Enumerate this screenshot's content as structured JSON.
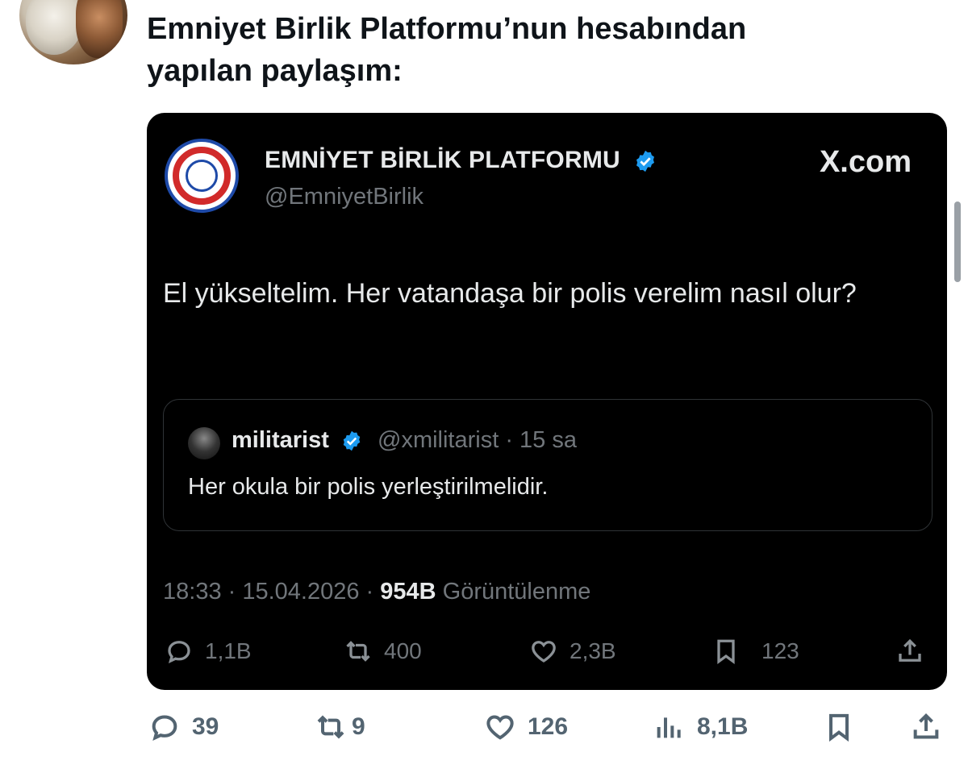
{
  "tweet": {
    "text": "Emniyet Birlik Platformu’nun hesabından\nyapılan paylaşım:"
  },
  "embedded_post": {
    "account_name": "EMNİYET BİRLİK PLATFORMU",
    "account_handle": "@EmniyetBirlik",
    "source": "X.com",
    "body": "El yükseltelim. Her vatandaşa bir polis verelim nasıl olur?",
    "quote": {
      "name": "militarist",
      "handle_time": "@xmilitarist · 15 sa",
      "body": "Her okula bir polis yerleştirilmelidir."
    },
    "timestamp": "18:33 · 15.04.2026 · ",
    "views_count": "954B",
    "views_label": " Görüntülenme",
    "actions": {
      "replies": "1,1B",
      "reposts": "400",
      "likes": "2,3B",
      "bookmarks": "123"
    }
  },
  "actions": {
    "replies": "39",
    "reposts": "9",
    "likes": "126",
    "views": "8,1B"
  },
  "colors": {
    "verified": "#1d9bf0",
    "card_bg": "#000000",
    "muted": "#71767b"
  }
}
